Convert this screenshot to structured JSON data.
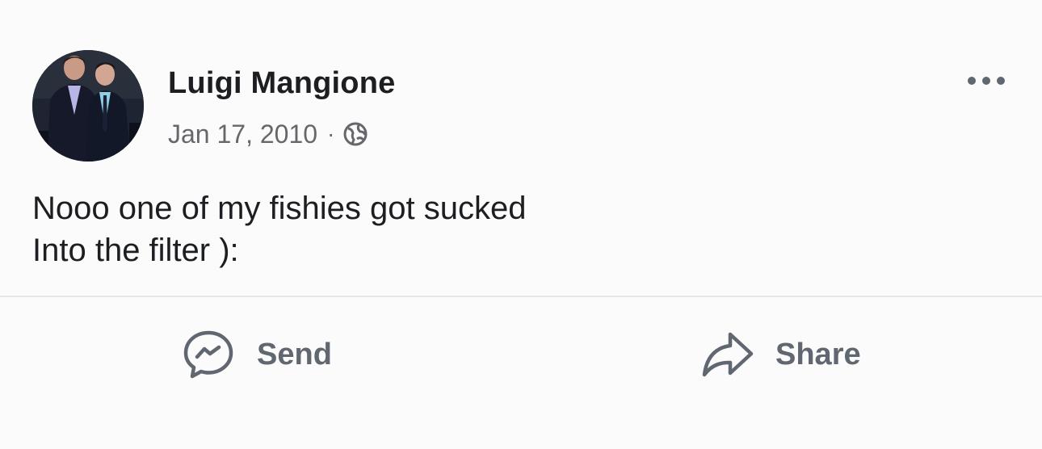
{
  "post": {
    "author": "Luigi Mangione",
    "date": "Jan 17, 2010",
    "separator": "·",
    "audience_icon": "globe-icon",
    "menu_icon": "more-options-icon",
    "text_lines": [
      "Nooo one of my fishies got sucked",
      "Into the filter ):"
    ]
  },
  "actions": {
    "send": {
      "label": "Send",
      "icon": "messenger-icon"
    },
    "share": {
      "label": "Share",
      "icon": "share-arrow-icon"
    }
  },
  "colors": {
    "background": "#fbfbfb",
    "name_text": "#1c1e21",
    "secondary_text": "#65676b",
    "action_text": "#606770",
    "divider": "#e4e6e9"
  }
}
